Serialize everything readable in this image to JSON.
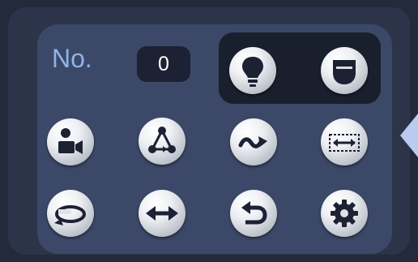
{
  "preset": {
    "label": "No.",
    "value": "0"
  },
  "buttons": {
    "light": "light-bulb-icon",
    "wiper": "camera-dome-icon",
    "record": "person-camera-icon",
    "tour": "triangle-nodes-icon",
    "pattern": "wave-arrow-icon",
    "scan": "dashed-box-arrows-icon",
    "rotate": "rotate-loop-icon",
    "pan": "double-arrow-icon",
    "return": "undo-arrow-icon",
    "settings": "gear-icon"
  },
  "colors": {
    "background": "#232a3c",
    "panel": "#3c4868",
    "label": "#8fb3e8",
    "icon": "#1c2233",
    "tab": "#b9cbef"
  }
}
